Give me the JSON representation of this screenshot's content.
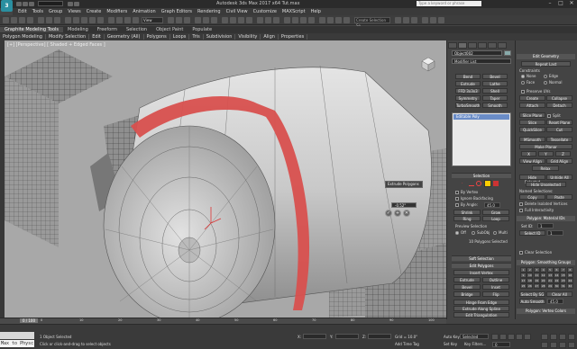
{
  "titlebar": {
    "logo": "3",
    "project_value": "",
    "title": "Autodesk 3ds Max 2017 x64   Tut.max",
    "search_placeholder": "Type a keyword or phrase",
    "min": "–",
    "max": "□",
    "close": "✕"
  },
  "menu": [
    "Edit",
    "Tools",
    "Group",
    "Views",
    "Create",
    "Modifiers",
    "Animation",
    "Graph Editors",
    "Rendering",
    "Civil View",
    "Customize",
    "MAXScript",
    "Help"
  ],
  "toolbar": {
    "view_select": "View",
    "named_selection": "Create Selection Se"
  },
  "ribbon": {
    "tabs": [
      "Modeling",
      "Freeform",
      "Selection",
      "Object Paint",
      "Populate"
    ],
    "title": "Graphite Modeling Tools",
    "subtabs": [
      "Polygon Modeling",
      "Modify Selection",
      "Edit",
      "Geometry (All)",
      "Polygons",
      "Loops",
      "Tris",
      "Subdivision",
      "Visibility",
      "Align",
      "Properties"
    ]
  },
  "viewport": {
    "label": "[+] [Perspective] [ Shaded + Edged Faces ]",
    "caddy": {
      "title": "Extrude Polygons",
      "value": "-0.52\"",
      "ok": "✓",
      "apply": "+",
      "cancel": "✕"
    }
  },
  "command_panel": {
    "object_name": "Object002",
    "modifier_list": "Modifier List",
    "modifier_buttons": [
      "Bend",
      "Bevel",
      "Extrude",
      "Lathe",
      "FFD 3x3x3",
      "Shell",
      "Symmetry",
      "Taper",
      "TurboSmooth",
      "Smooth"
    ],
    "stack_item": "Editable Poly",
    "selection_header": "Selection",
    "by_vertex": "By Vertex",
    "ignore_backfacing": "Ignore Backfacing",
    "by_angle": "By Angle:",
    "angle_value": "45.0",
    "shrink": "Shrink",
    "grow": "Grow",
    "ring": "Ring",
    "loop": "Loop",
    "preview_selection": "Preview Selection",
    "preview_opts": [
      "Off",
      "SubObj",
      "Multi"
    ],
    "selected_info": "10 Polygons Selected",
    "soft_selection": "Soft Selection",
    "edit_polygons": "Edit Polygons",
    "insert_vertex": "Insert Vertex",
    "edit_buttons": [
      "Extrude",
      "Outline",
      "Bevel",
      "Inset",
      "Bridge",
      "Flip"
    ],
    "hinge": "Hinge From Edge",
    "extrude_spline": "Extrude Along Spline",
    "edit_tri": "Edit Triangulation",
    "retriangulate": "Retriangulate",
    "turn": "Turn"
  },
  "right_panel": {
    "edit_geometry": "Edit Geometry",
    "repeat_last": "Repeat Last",
    "constraints": "Constraints",
    "con_opts": [
      "None",
      "Edge",
      "Face",
      "Normal"
    ],
    "preserve_uvs": "Preserve UVs",
    "create": "Create",
    "collapse": "Collapse",
    "attach": "Attach",
    "detach": "Detach",
    "slice_plane": "Slice Plane",
    "split": "Split",
    "slice": "Slice",
    "reset_plane": "Reset Plane",
    "quickslice": "QuickSlice",
    "cut": "Cut",
    "msmooth": "MSmooth",
    "tessellate": "Tessellate",
    "make_planar": "Make Planar",
    "xyz": [
      "X",
      "Y",
      "Z"
    ],
    "view_align": "View Align",
    "grid_align": "Grid Align",
    "relax": "Relax",
    "hide_selected": "Hide Selected",
    "unhide_all": "Unhide All",
    "hide_unselected": "Hide Unselected",
    "named_selections": "Named Selections:",
    "copy": "Copy",
    "paste": "Paste",
    "delete_isolated": "Delete Isolated Vertices",
    "full_interactivity": "Full Interactivity",
    "material_ids": "Polygon: Material IDs",
    "set_id": "Set ID:",
    "set_id_val": "1",
    "select_id": "Select ID",
    "select_id_val": "1",
    "clear_selection": "Clear Selection",
    "smoothing_groups": "Polygon: Smoothing Groups",
    "sg_numbers": [
      "1",
      "2",
      "3",
      "4",
      "5",
      "6",
      "7",
      "8",
      "9",
      "10",
      "11",
      "12",
      "13",
      "14",
      "15",
      "16",
      "17",
      "18",
      "19",
      "20",
      "21",
      "22",
      "23",
      "24",
      "25",
      "26",
      "27",
      "28",
      "29",
      "30",
      "31",
      "32"
    ],
    "select_by_sg": "Select By SG",
    "clear_all": "Clear All",
    "auto_smooth": "Auto Smooth",
    "auto_smooth_val": "45.0",
    "vertex_colors": "Polygon: Vertex Colors",
    "color": "Color:",
    "illum": "Illum:"
  },
  "timeline": {
    "slider": "0 / 100",
    "ticks": [
      "0",
      "10",
      "20",
      "30",
      "40",
      "50",
      "60",
      "70",
      "80",
      "90",
      "100"
    ]
  },
  "status": {
    "maxscript": "Max to Physc",
    "selected": "1 Object Selected",
    "prompt": "Click or click-and-drag to select objects",
    "x": "X:",
    "y": "Y:",
    "z": "Z:",
    "grid": "Grid = 10.0\"",
    "add_time_tag": "Add Time Tag",
    "auto_key": "Auto Key",
    "auto_key_sel": "Selected",
    "set_key": "Set Key",
    "key_filters": "Key Filters...",
    "frame": "0"
  },
  "colors": {
    "highlight": "#d8504e",
    "stack_sel": "#6a8cc7",
    "accent": "#2a8fa0"
  }
}
